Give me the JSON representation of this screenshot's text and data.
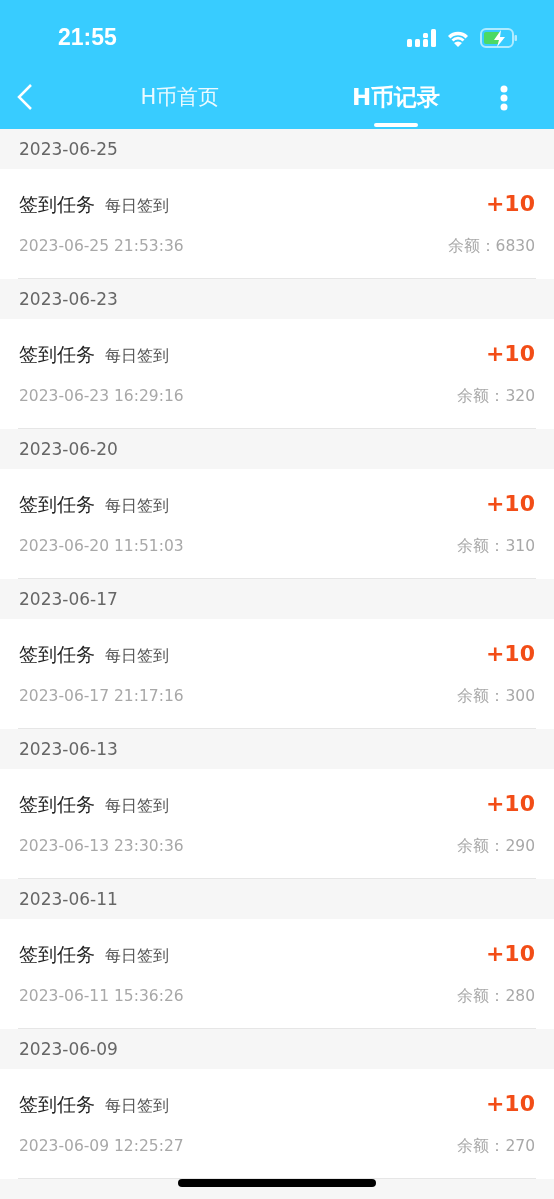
{
  "status_bar": {
    "time": "21:55"
  },
  "nav": {
    "tabs": [
      {
        "label": "H币首页",
        "selected": false
      },
      {
        "label": "H币记录",
        "selected": true
      }
    ]
  },
  "groups": [
    {
      "date": "2023-06-25",
      "records": [
        {
          "title": "签到任务",
          "subtitle": "每日签到",
          "amount": "+10",
          "time": "2023-06-25 21:53:36",
          "balance": "余额：6830"
        }
      ]
    },
    {
      "date": "2023-06-23",
      "records": [
        {
          "title": "签到任务",
          "subtitle": "每日签到",
          "amount": "+10",
          "time": "2023-06-23 16:29:16",
          "balance": "余额：320"
        }
      ]
    },
    {
      "date": "2023-06-20",
      "records": [
        {
          "title": "签到任务",
          "subtitle": "每日签到",
          "amount": "+10",
          "time": "2023-06-20 11:51:03",
          "balance": "余额：310"
        }
      ]
    },
    {
      "date": "2023-06-17",
      "records": [
        {
          "title": "签到任务",
          "subtitle": "每日签到",
          "amount": "+10",
          "time": "2023-06-17 21:17:16",
          "balance": "余额：300"
        }
      ]
    },
    {
      "date": "2023-06-13",
      "records": [
        {
          "title": "签到任务",
          "subtitle": "每日签到",
          "amount": "+10",
          "time": "2023-06-13 23:30:36",
          "balance": "余额：290"
        }
      ]
    },
    {
      "date": "2023-06-11",
      "records": [
        {
          "title": "签到任务",
          "subtitle": "每日签到",
          "amount": "+10",
          "time": "2023-06-11 15:36:26",
          "balance": "余额：280"
        }
      ]
    },
    {
      "date": "2023-06-09",
      "records": [
        {
          "title": "签到任务",
          "subtitle": "每日签到",
          "amount": "+10",
          "time": "2023-06-09 12:25:27",
          "balance": "余额：270"
        }
      ]
    }
  ]
}
